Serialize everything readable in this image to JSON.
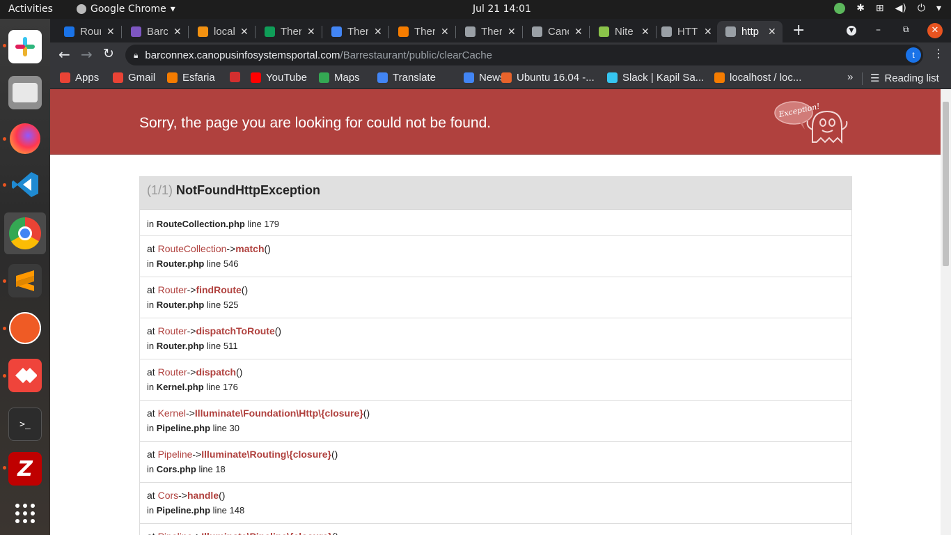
{
  "topbar": {
    "activities": "Activities",
    "app": "Google Chrome",
    "clock": "Jul 21  14:01"
  },
  "tabs": [
    {
      "label": "Rour",
      "color": "#1a73e8"
    },
    {
      "label": "Barc",
      "color": "#7e57c2"
    },
    {
      "label": "local",
      "color": "#f29111"
    },
    {
      "label": "Ther",
      "color": "#0f9d58"
    },
    {
      "label": "Ther",
      "color": "#4285f4"
    },
    {
      "label": "Ther",
      "color": "#f57c00"
    },
    {
      "label": "Ther",
      "color": "#9aa0a6"
    },
    {
      "label": "Canc",
      "color": "#9aa0a6"
    },
    {
      "label": "Nite",
      "color": "#8bc34a"
    },
    {
      "label": "HTTI",
      "color": "#9aa0a6"
    },
    {
      "label": "http",
      "color": "#9aa0a6"
    }
  ],
  "omnibox": {
    "domain": "barconnex.canopusinfosystemsportal.com",
    "path": "/Barrestaurant/public/clearCache"
  },
  "profile_initial": "t",
  "bookmarks": [
    {
      "label": "Apps",
      "color": "#ea4335"
    },
    {
      "label": "Gmail",
      "color": "#ea4335"
    },
    {
      "label": "Esfaria",
      "color": "#f57c00"
    },
    {
      "label": "",
      "color": "#d32f2f"
    },
    {
      "label": "YouTube",
      "color": "#ff0000"
    },
    {
      "label": "Maps",
      "color": "#34a853"
    },
    {
      "label": "Translate",
      "color": "#4285f4"
    },
    {
      "label": "News",
      "color": "#4285f4"
    },
    {
      "label": "Ubuntu 16.04 -...",
      "color": "#e8632b"
    },
    {
      "label": "Slack | Kapil Sa...",
      "color": "#36c5f0"
    },
    {
      "label": "localhost / loc...",
      "color": "#f57c00"
    }
  ],
  "bookmarks_more": "»",
  "reading_list": "Reading list",
  "error": {
    "heading": "Sorry, the page you are looking for could not be found.",
    "mascot_text": "Exception!",
    "count": "(1/1)",
    "exception": "NotFoundHttpException",
    "first": {
      "file": "RouteCollection.php",
      "line": "line 179"
    },
    "frames": [
      {
        "cls": "RouteCollection",
        "fn": "match",
        "file": "Router.php",
        "line": "line 546"
      },
      {
        "cls": "Router",
        "fn": "findRoute",
        "file": "Router.php",
        "line": "line 525"
      },
      {
        "cls": "Router",
        "fn": "dispatchToRoute",
        "file": "Router.php",
        "line": "line 511"
      },
      {
        "cls": "Router",
        "fn": "dispatch",
        "file": "Kernel.php",
        "line": "line 176"
      },
      {
        "cls": "Kernel",
        "fn": "Illuminate\\Foundation\\Http\\{closure}",
        "file": "Pipeline.php",
        "line": "line 30"
      },
      {
        "cls": "Pipeline",
        "fn": "Illuminate\\Routing\\{closure}",
        "file": "Cors.php",
        "line": "line 18"
      },
      {
        "cls": "Cors",
        "fn": "handle",
        "file": "Pipeline.php",
        "line": "line 148"
      },
      {
        "cls": "Pipeline",
        "fn": "Illuminate\\Pipeline\\{closure}",
        "file": "",
        "line": ""
      }
    ]
  },
  "labels": {
    "at": "at",
    "in": "in",
    "arrow": "->",
    "parens": "()"
  }
}
